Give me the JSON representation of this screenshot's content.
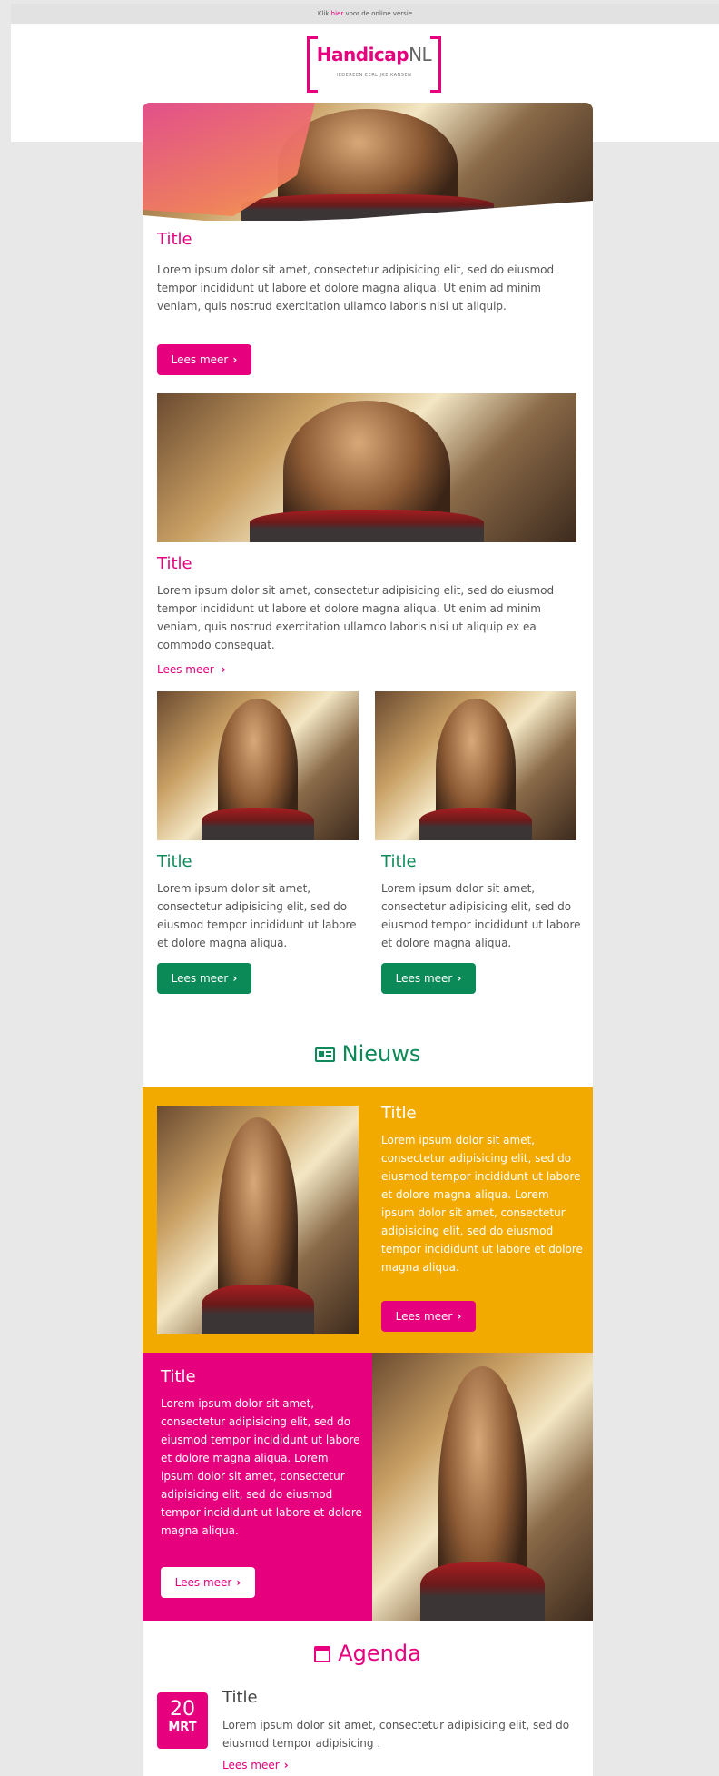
{
  "topbar": {
    "text_before": "Klik ",
    "link": "hier",
    "text_after": " voor de online versie"
  },
  "logo": {
    "name_main": "Handicap",
    "name_suffix": "NL",
    "tagline": "IEDEREEN EERLIJKE KANSEN"
  },
  "articles": [
    {
      "title": "Title",
      "body": "Lorem ipsum dolor sit amet, consectetur adipisicing elit, sed do eiusmod tempor incididunt ut labore et dolore magna aliqua. Ut enim ad minim veniam, quis nostrud exercitation ullamco laboris nisi ut aliquip.",
      "button": "Lees meer"
    },
    {
      "title": "Title",
      "body": "Lorem ipsum dolor sit amet, consectetur adipisicing elit, sed do eiusmod tempor incididunt ut labore et dolore magna aliqua. Ut enim ad minim veniam, quis nostrud exercitation ullamco laboris nisi ut aliquip ex ea commodo consequat.",
      "link": "Lees meer"
    },
    {
      "title": "Title",
      "body": "Lorem ipsum dolor sit amet, consectetur adipisicing elit, sed do eiusmod tempor incididunt ut labore et dolore magna aliqua.",
      "button": "Lees meer"
    },
    {
      "title": "Title",
      "body": "Lorem ipsum dolor sit amet, consectetur adipisicing elit, sed do eiusmod tempor incididunt ut labore et dolore magna aliqua.",
      "button": "Lees meer"
    }
  ],
  "nieuws": {
    "heading": "Nieuws",
    "items": [
      {
        "title": "Title",
        "body": "Lorem ipsum dolor sit amet, consectetur adipisicing elit, sed do eiusmod tempor incididunt ut labore et dolore magna aliqua. Lorem ipsum dolor sit amet, consectetur adipisicing elit, sed do eiusmod tempor incididunt ut labore et dolore magna aliqua.",
        "button": "Lees meer"
      },
      {
        "title": "Title",
        "body": "Lorem ipsum dolor sit amet, consectetur adipisicing elit, sed do eiusmod tempor incididunt ut labore et dolore magna aliqua. Lorem ipsum dolor sit amet, consectetur adipisicing elit, sed do eiusmod tempor incididunt ut labore et dolore magna aliqua.",
        "button": "Lees meer"
      }
    ]
  },
  "agenda": {
    "heading": "Agenda",
    "event": {
      "day": "20",
      "month": "MRT",
      "title": "Title",
      "body": "Lorem ipsum dolor sit amet, consectetur adipisicing elit, sed do eiusmod tempor adipisicing .",
      "link": "Lees meer"
    }
  },
  "colors": {
    "pink": "#e6007e",
    "green": "#0b8a58",
    "orange": "#f2aa00"
  },
  "icons": {
    "chevron": "chevron-right-icon",
    "nieuws": "newspaper-icon",
    "agenda": "calendar-icon"
  }
}
